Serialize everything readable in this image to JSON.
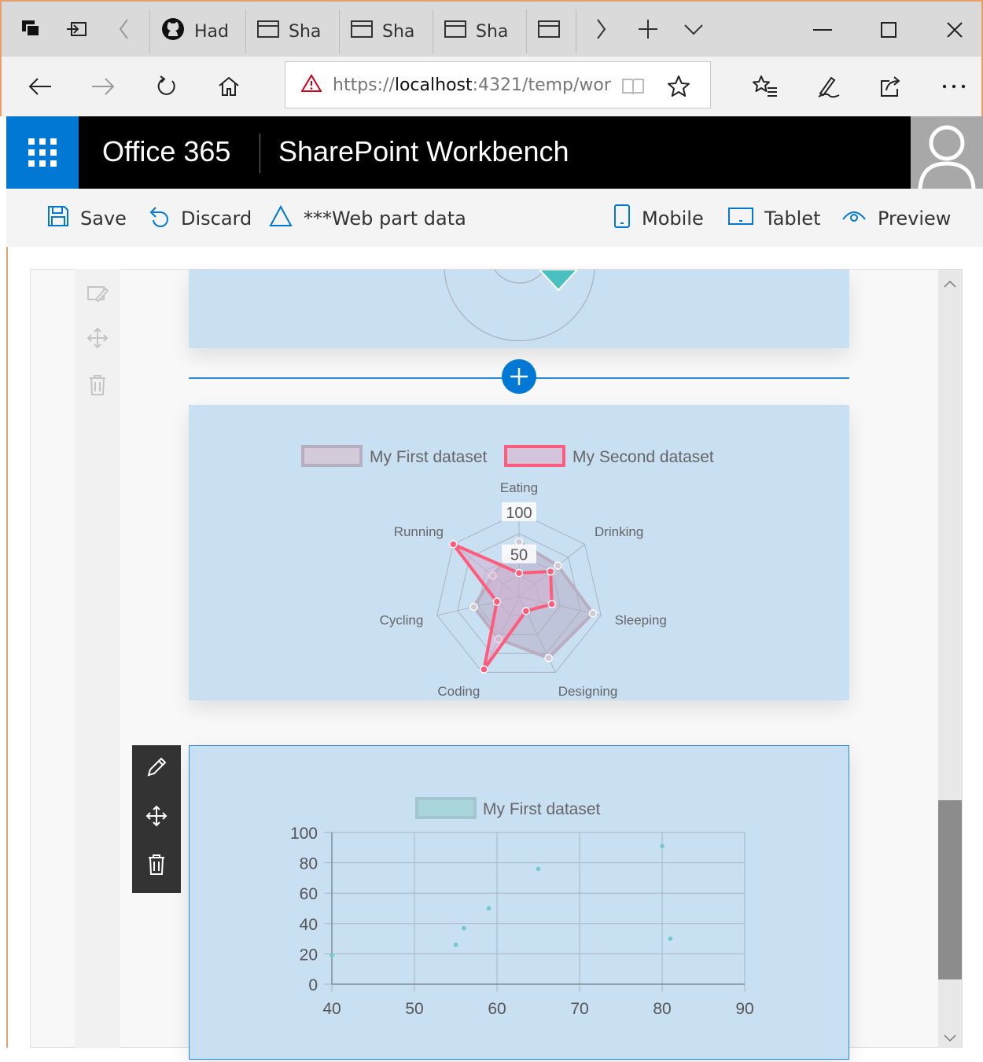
{
  "browser": {
    "tabs": [
      {
        "label": "Had",
        "icon": "github-icon"
      },
      {
        "label": "Sha",
        "icon": "window-icon"
      },
      {
        "label": "Sha",
        "icon": "window-icon"
      },
      {
        "label": "Sha",
        "icon": "window-icon"
      },
      {
        "label": "",
        "icon": "window-icon"
      }
    ],
    "url_prefix": "https://",
    "url_host": "localhost",
    "url_rest": ":4321/temp/wor"
  },
  "suite": {
    "brand": "Office 365",
    "app_title": "SharePoint Workbench"
  },
  "commands": {
    "save": "Save",
    "discard": "Discard",
    "web_part_data": "***Web part data",
    "mobile": "Mobile",
    "tablet": "Tablet",
    "preview": "Preview"
  },
  "colors": {
    "accent": "#0078d4",
    "webpart_bg": "#c9dff2",
    "dataset1_stroke": "#b9aec0",
    "dataset2_stroke": "#ff5c7c",
    "scatter_point": "#6ecdc8"
  },
  "chart_data": [
    {
      "type": "radar",
      "labels": [
        "Eating",
        "Drinking",
        "Sleeping",
        "Designing",
        "Coding",
        "Cycling",
        "Running"
      ],
      "ticks": [
        "50",
        "100"
      ],
      "rmax": 100,
      "series": [
        {
          "name": "My First dataset",
          "values": [
            65,
            59,
            90,
            81,
            56,
            55,
            40
          ]
        },
        {
          "name": "My Second dataset",
          "values": [
            28,
            48,
            40,
            19,
            96,
            27,
            100
          ]
        }
      ]
    },
    {
      "type": "scatter",
      "legend": "My First dataset",
      "xlim": [
        40,
        90
      ],
      "ylim": [
        0,
        100
      ],
      "xticks": [
        "40",
        "50",
        "60",
        "70",
        "80",
        "90"
      ],
      "yticks": [
        "0",
        "20",
        "40",
        "60",
        "80",
        "100"
      ],
      "points": [
        [
          40,
          19
        ],
        [
          55,
          26
        ],
        [
          56,
          37
        ],
        [
          59,
          50
        ],
        [
          65,
          76
        ],
        [
          80,
          91
        ],
        [
          81,
          30
        ]
      ]
    }
  ]
}
